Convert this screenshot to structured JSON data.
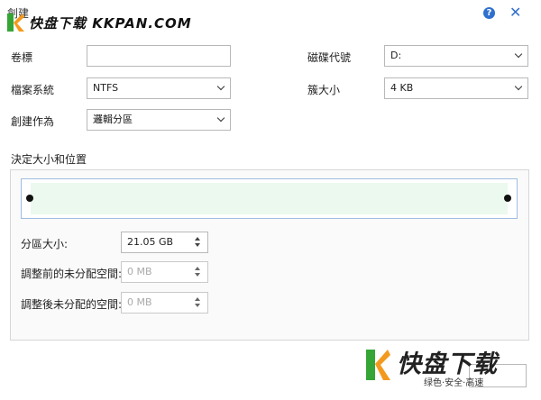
{
  "window": {
    "title": "創建"
  },
  "watermark_top": {
    "text": "快盘下载 KKPAN.COM"
  },
  "watermark_bottom": {
    "main": "快盘下载",
    "tagline": "绿色·安全·高速"
  },
  "fields": {
    "volume_label": {
      "label": "卷標",
      "value": ""
    },
    "drive_letter": {
      "label": "磁碟代號",
      "value": "D:"
    },
    "file_system": {
      "label": "檔案系統",
      "value": "NTFS"
    },
    "cluster_size": {
      "label": "簇大小",
      "value": "4 KB"
    },
    "create_as": {
      "label": "創建作為",
      "value": "邏輯分區"
    }
  },
  "size_section": {
    "title": "決定大小和位置",
    "partition_size": {
      "label": "分區大小:",
      "value": "21.05 GB"
    },
    "unalloc_before": {
      "label": "調整前的未分配空間:",
      "value": "0 MB"
    },
    "unalloc_after": {
      "label": "調整後未分配的空間:",
      "value": "0 MB"
    }
  },
  "colors": {
    "accent": "#2f6fce",
    "bar_fill": "#ecf9ee",
    "bar_border": "#9fbde0",
    "logo_green": "#35a635",
    "logo_orange": "#f39a1e"
  }
}
